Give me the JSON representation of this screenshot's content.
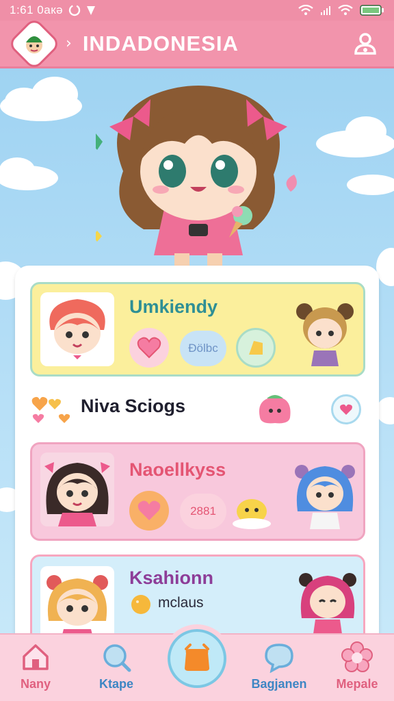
{
  "status_bar": {
    "time": "1:61 0aкə",
    "signal_icon": "cellular-icon",
    "wifi_icon": "wifi-icon",
    "battery_icon": "battery-icon"
  },
  "header": {
    "title": "INDADONESIA",
    "breadcrumb_separator": "›",
    "logo_icon": "mascot-logo-icon",
    "user_icon": "user-settings-icon"
  },
  "hero": {
    "icon": "mascot-girl-illustration"
  },
  "cards": [
    {
      "name": "Umkiendy",
      "pill_label": "Đölbc",
      "colors": {
        "bg": "#fbef9c",
        "text": "#2e8f95"
      }
    },
    {
      "name": "Niva Sciogs"
    },
    {
      "name": "Naoellkyss",
      "pill_label": "2881",
      "colors": {
        "bg": "#f8c8dc",
        "text": "#e45573"
      }
    },
    {
      "name": "Ksahionn",
      "sub_label": "mclaus",
      "colors": {
        "bg": "#d4eefa",
        "text": "#8d3d98"
      }
    }
  ],
  "bottom_nav": {
    "items": [
      {
        "label": "Nany",
        "icon": "home-icon",
        "color": "#e0607f"
      },
      {
        "label": "Ktape",
        "icon": "search-icon",
        "color": "#3d86c4"
      },
      {
        "label": "Bagjanen",
        "icon": "chat-bubble-icon",
        "color": "#3d86c4"
      },
      {
        "label": "Mepale",
        "icon": "flower-icon",
        "color": "#e0607f"
      }
    ],
    "center_icon": "orange-bag-icon"
  },
  "colors": {
    "accent": "#f294ac",
    "sky": "#9fd3f2"
  }
}
